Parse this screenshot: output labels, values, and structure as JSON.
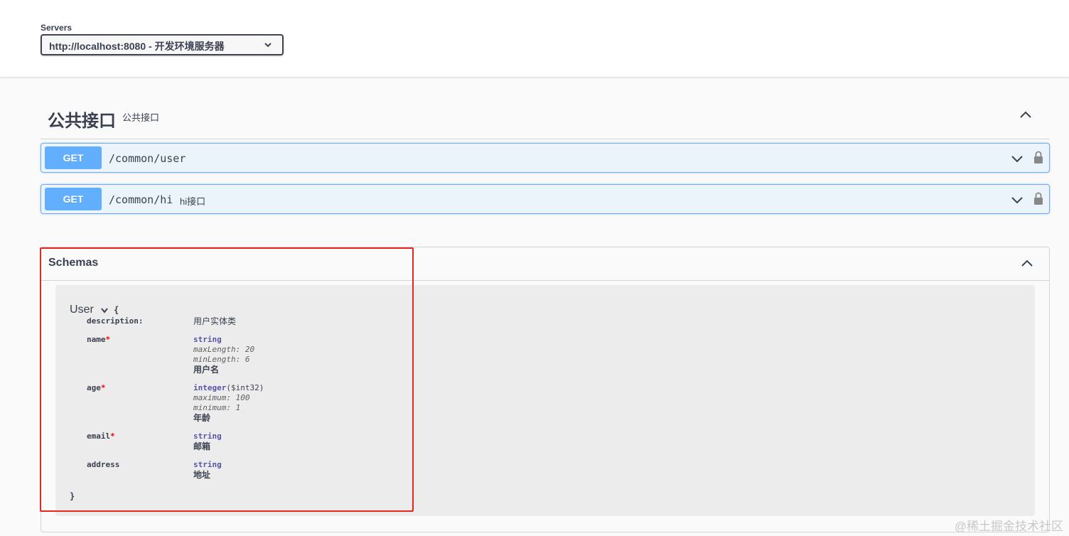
{
  "servers": {
    "label": "Servers",
    "selected": "http://localhost:8080 - 开发环境服务器"
  },
  "tag": {
    "name": "公共接口",
    "description": "公共接口"
  },
  "operations": [
    {
      "method": "GET",
      "path": "/common/user",
      "summary": ""
    },
    {
      "method": "GET",
      "path": "/common/hi",
      "summary": "hi接口"
    }
  ],
  "schemas": {
    "title": "Schemas",
    "model": {
      "name": "User",
      "open_brace": "{",
      "close_brace": "}",
      "description_label": "description:",
      "description": "用户实体类",
      "properties": [
        {
          "name": "name",
          "required": "*",
          "type": "string",
          "format": "",
          "constraints": [
            "maxLength: 20",
            "minLength: 6"
          ],
          "description": "用户名"
        },
        {
          "name": "age",
          "required": "*",
          "type": "integer",
          "format": "($int32)",
          "constraints": [
            "maximum: 100",
            "minimum: 1"
          ],
          "description": "年龄"
        },
        {
          "name": "email",
          "required": "*",
          "type": "string",
          "format": "",
          "constraints": [],
          "description": "邮箱"
        },
        {
          "name": "address",
          "required": "",
          "type": "string",
          "format": "",
          "constraints": [],
          "description": "地址"
        }
      ]
    }
  },
  "watermark": "@稀土掘金技术社区",
  "colors": {
    "get": "#61affe",
    "get_bg": "#ebf3fb",
    "highlight": "#e8251f",
    "required": "#ff0000",
    "type": "#5555aa"
  }
}
